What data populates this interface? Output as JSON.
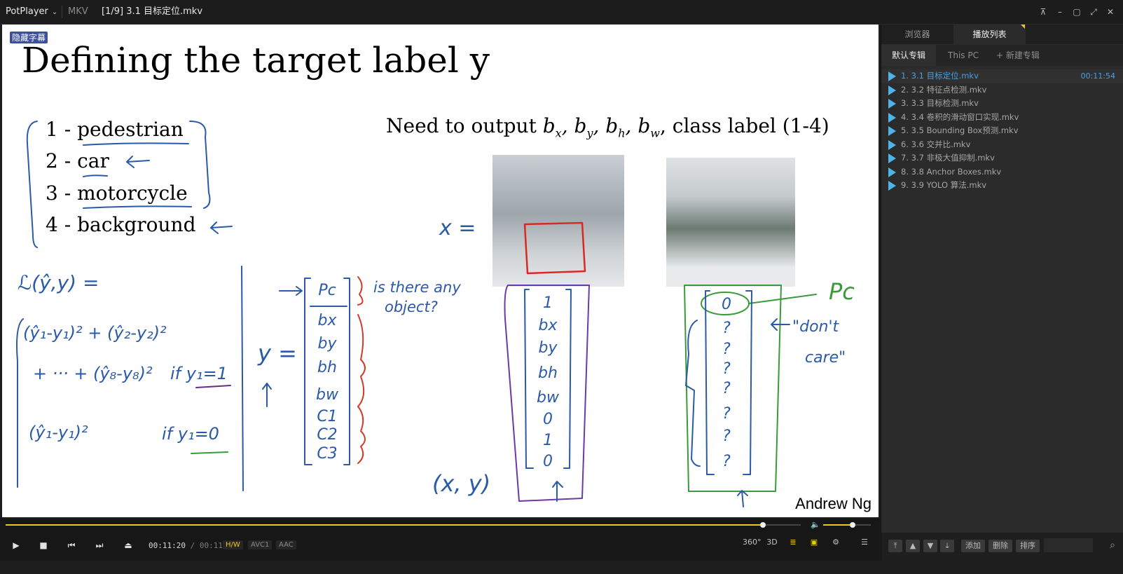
{
  "titlebar": {
    "app_name": "PotPlayer",
    "format": "MKV",
    "title": "[1/9] 3.1 目标定位.mkv",
    "buttons": [
      "pin",
      "minimize",
      "maximize",
      "fullscreen",
      "close"
    ]
  },
  "video": {
    "subtitle_tag": "隐藏字幕",
    "slide_title": "Defining the target label y",
    "classes": [
      "1 -  pedestrian",
      "2 -  car",
      "3 -  motorcycle",
      "4 -  background"
    ],
    "need_output_prefix": "Need to output",
    "need_output_suffix": "class label (1-4)",
    "author": "Andrew Ng",
    "handwriting": {
      "x_eq": "x =",
      "loss": "ℒ(ŷ,y) =",
      "sq1": "(ŷ₁-y₁)² + (ŷ₂-y₂)²",
      "sq2": "+ ··· + (ŷ₈-y₈)²",
      "if1": "if y₁=1",
      "sq3": "(ŷ₁-y₁)²",
      "if0": "if y₁=0",
      "y_eq": "y =",
      "vec_labels": [
        "Pc",
        "bx",
        "by",
        "bh",
        "bw",
        "C1",
        "C2",
        "C3"
      ],
      "is_there": "is there any",
      "object": "object?",
      "vec1": [
        "1",
        "bx",
        "by",
        "bh",
        "bw",
        "0",
        "1",
        "0"
      ],
      "vec2": [
        "0",
        "?",
        "?",
        "?",
        "?",
        "?",
        "?",
        "?"
      ],
      "pc_note": "Pc",
      "dont_care": [
        "\"don't",
        "care\""
      ],
      "xy": "(x, y)"
    }
  },
  "controls": {
    "current_time": "00:11:20",
    "separator": "/",
    "duration": "00:11:54",
    "progress": 0.952,
    "volume": 0.62,
    "badges": [
      {
        "label": "H/W",
        "color": "#e9c919"
      },
      {
        "label": "AVC1",
        "color": "#8a8a8a"
      },
      {
        "label": "AAC",
        "color": "#8a8a8a"
      }
    ],
    "right_buttons": [
      "360°",
      "3D",
      "≣",
      "▣",
      "⚙",
      "☰"
    ]
  },
  "panel": {
    "tabs": [
      "浏览器",
      "播放列表"
    ],
    "active_tab": 1,
    "albums": [
      "默认专辑",
      "This PC",
      "+ 新建专辑"
    ],
    "playlist": [
      {
        "title": "1. 3.1 目标定位.mkv",
        "duration": "00:11:54",
        "current": true
      },
      {
        "title": "2. 3.2 特征点检测.mkv",
        "duration": "",
        "current": false
      },
      {
        "title": "3. 3.3 目标检测.mkv",
        "duration": "",
        "current": false
      },
      {
        "title": "4. 3.4 卷积的滑动窗口实现.mkv",
        "duration": "",
        "current": false
      },
      {
        "title": "5. 3.5 Bounding Box预测.mkv",
        "duration": "",
        "current": false
      },
      {
        "title": "6. 3.6 交并比.mkv",
        "duration": "",
        "current": false
      },
      {
        "title": "7. 3.7 非极大值抑制.mkv",
        "duration": "",
        "current": false
      },
      {
        "title": "8. 3.8 Anchor Boxes.mkv",
        "duration": "",
        "current": false
      },
      {
        "title": "9. 3.9 YOLO 算法.mkv",
        "duration": "",
        "current": false
      }
    ],
    "footer": {
      "add": "添加",
      "delete": "删除",
      "sort": "排序"
    }
  }
}
